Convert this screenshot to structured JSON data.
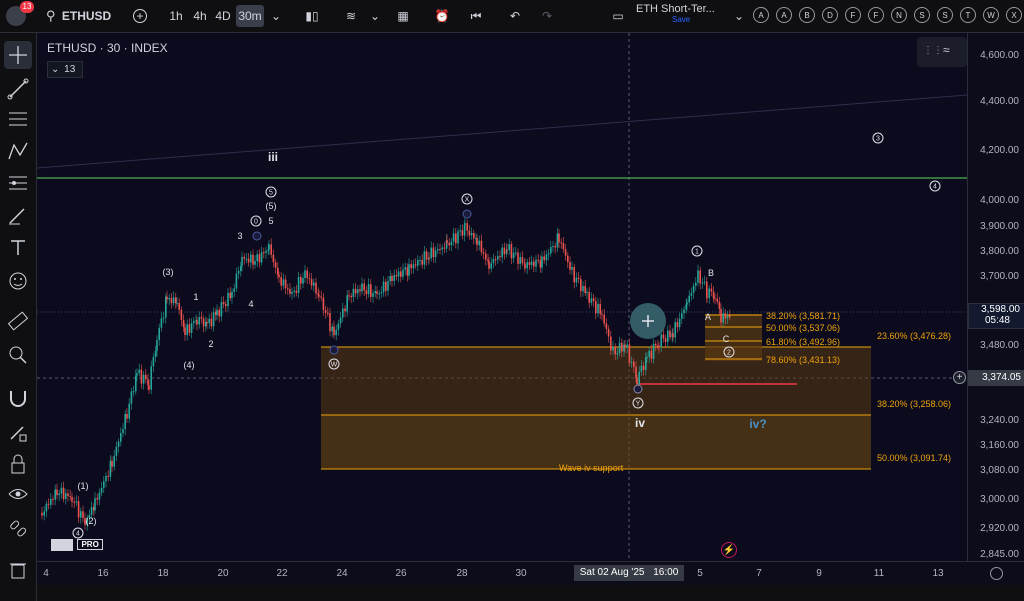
{
  "topbar": {
    "notification_count": "13",
    "symbol": "ETHUSD",
    "intervals": [
      "1h",
      "4h",
      "4D",
      "30m"
    ],
    "active_interval": "30m",
    "layout_name": "ETH Short-Ter...",
    "layout_status": "Save",
    "letters": [
      "A",
      "A",
      "B",
      "D",
      "F",
      "F",
      "N",
      "S",
      "S",
      "T",
      "W",
      "X"
    ]
  },
  "legend": {
    "title": "ETHUSD · 30 · INDEX",
    "indicator_count": "13"
  },
  "price_axis": {
    "ticks": [
      "4,600.00",
      "4,400.00",
      "4,200.00",
      "4,000.00",
      "3,900.00",
      "3,800.00",
      "3,700.00",
      "3,600.00",
      "3,480.00",
      "3,360.00",
      "3,240.00",
      "3,160.00",
      "3,080.00",
      "3,000.00",
      "2,920.00",
      "2,845.00"
    ],
    "current_price": "3,598.00",
    "countdown": "05:48",
    "crosshair_price": "3,374.05"
  },
  "time_axis": {
    "ticks": [
      "4",
      "16",
      "18",
      "20",
      "22",
      "24",
      "26",
      "28",
      "30",
      "5",
      "7",
      "9",
      "11",
      "13"
    ],
    "crosshair_label": "Sat 02 Aug '25",
    "crosshair_time": "16:00"
  },
  "waves": {
    "iii": "iii",
    "iv": "iv",
    "iv_q": "iv?",
    "w1": "(1)",
    "w2": "(2)",
    "w3": "(3)",
    "w4": "(4)",
    "w5": "(5)",
    "m1": "1",
    "m2": "2",
    "m3": "3",
    "m4": "4",
    "m5": "5",
    "c0": "0",
    "c5": "5",
    "c4": "4",
    "cW": "W",
    "cX": "X",
    "cY": "Y",
    "c1r": "1",
    "c2r": "2",
    "c3r": "3",
    "c4r": "4",
    "A": "A",
    "B": "B",
    "C": "C"
  },
  "fib_small": [
    "38.20% (3,581.71)",
    "50.00% (3,537.06)",
    "61.80% (3,492.96)",
    "78.60% (3,431.13)"
  ],
  "fib_big": [
    "23.60% (3,476.28)",
    "38.20% (3,258.06)",
    "50.00% (3,091.74)"
  ],
  "support_label": "Wave iv support",
  "colors": {
    "up": "#26a69a",
    "down": "#ef5350",
    "fib": "#f0a30a",
    "green_line": "#4caf50",
    "red_line": "#f23645"
  }
}
